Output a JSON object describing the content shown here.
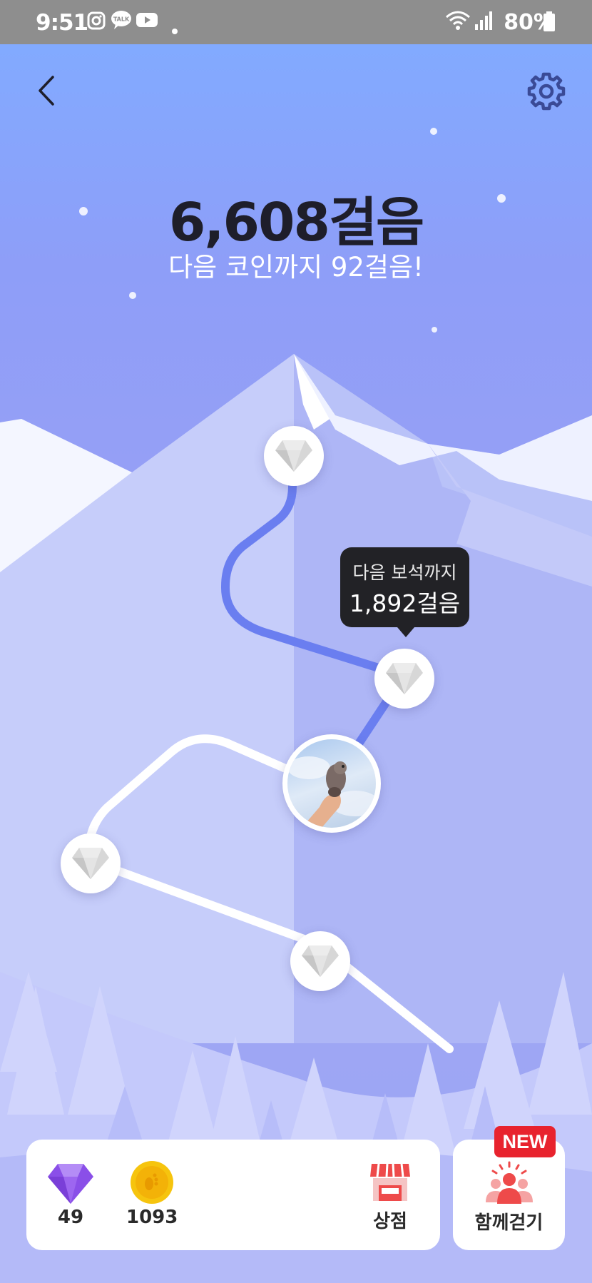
{
  "status_bar": {
    "time": "9:51",
    "battery": "80%",
    "icons": [
      "instagram-icon",
      "kakaotalk-icon",
      "youtube-icon",
      "dot-icon",
      "wifi-icon",
      "signal-icon",
      "battery-icon"
    ],
    "kakao_label": "TALK"
  },
  "header": {
    "back_icon": "chevron-left-icon",
    "settings_icon": "gear-icon"
  },
  "steps": {
    "total": "6,608걸음",
    "next_coin": "다음 코인까지 92걸음!"
  },
  "tooltip": {
    "line1": "다음 보석까지",
    "line2": "1,892걸음"
  },
  "bottom": {
    "gems": {
      "icon": "diamond-icon",
      "count": "49"
    },
    "coins": {
      "icon": "coin-icon",
      "count": "1093"
    },
    "shop": {
      "icon": "store-icon",
      "label": "상점"
    },
    "walk_together": {
      "icon": "group-icon",
      "label": "함께걷기",
      "badge": "NEW"
    }
  },
  "colors": {
    "accent_path": "#6a7ef0",
    "badge_red": "#e8232e",
    "gem_purple": "#8a4fe8",
    "coin_yellow": "#f6c40e"
  }
}
